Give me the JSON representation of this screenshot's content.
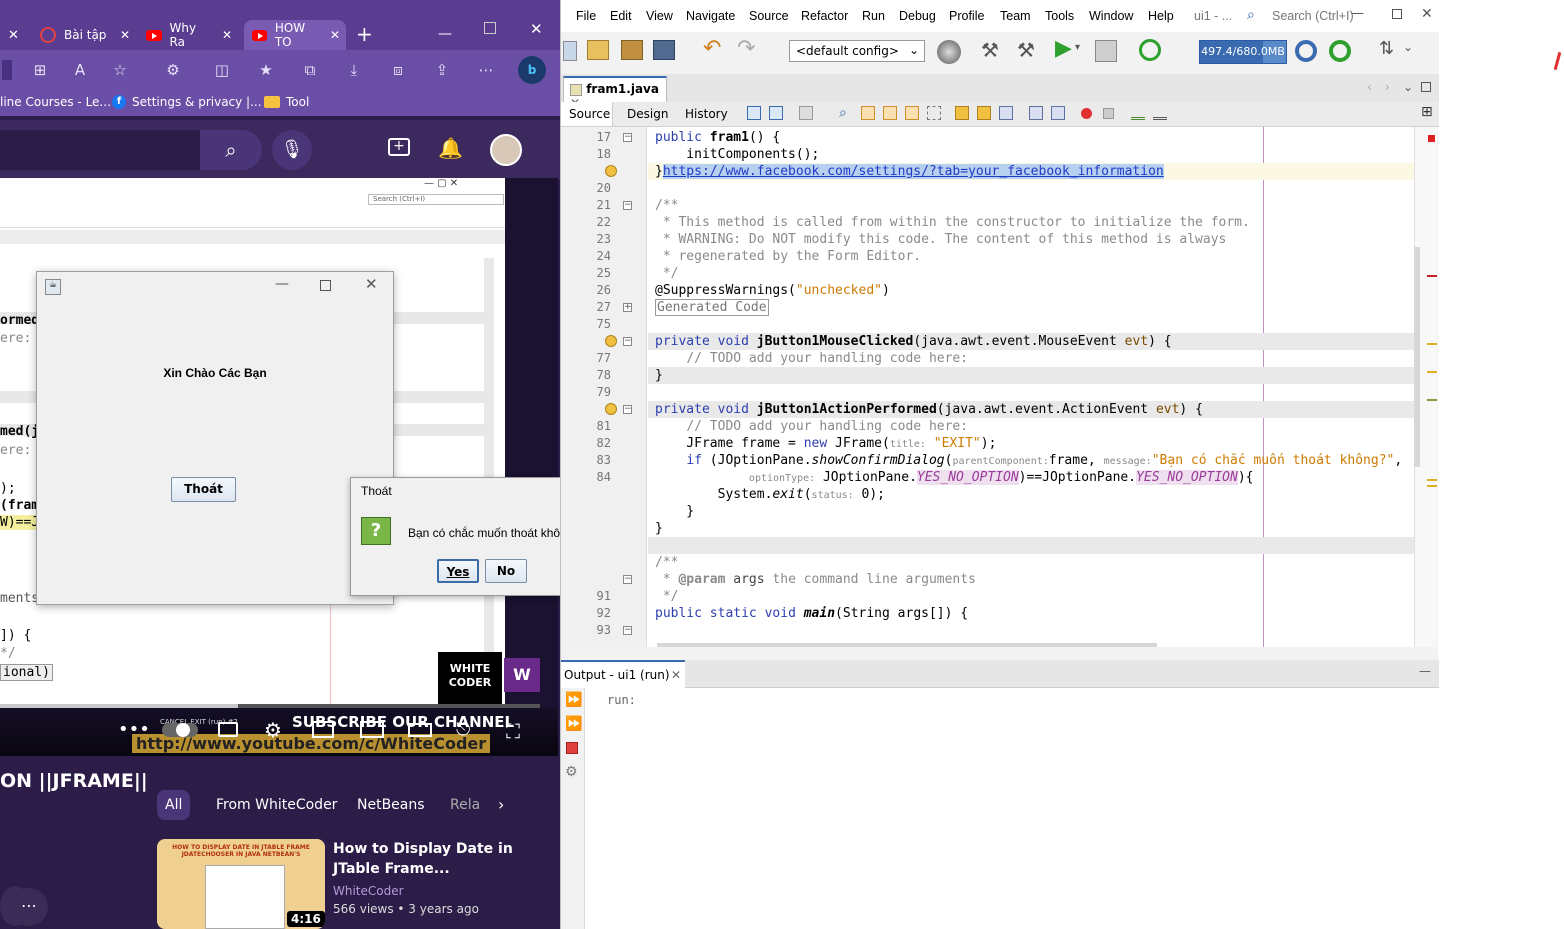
{
  "browser": {
    "tabs": [
      {
        "label": "",
        "active": false
      },
      {
        "label": "Bài tập",
        "active": false
      },
      {
        "label": "Why Ra",
        "active": false
      },
      {
        "label": "HOW TO",
        "active": true
      }
    ],
    "new_tab": "+",
    "favorites": [
      "line Courses - Le...",
      "Settings & privacy |...",
      "Tool"
    ],
    "video": {
      "dialog_title": "",
      "greeting": "Xin Chào Các Bạn",
      "exit_button": "Thoát",
      "confirm": {
        "title": "Thoát",
        "message": "Bạn có chắc muốn thoát không?",
        "yes": "Yes",
        "no": "No"
      },
      "code_fragments": [
        "ormed",
        "ere:",
        "med(j",
        "ere:",
        ");",
        "(fram",
        "W)==J",
        "ments",
        "]) {",
        "*/",
        "ional)"
      ],
      "watermark_title": "WHITE CODER",
      "subscribe_text": "SUBSCRIBE OUR CHANNEL",
      "channel_url": "http://www.youtube.com/c/WhiteCoder",
      "mini_caption": "CANCEL EXIT (run) #2",
      "mini_search": "Search (Ctrl+I)"
    },
    "video_title": "ON ||JFRAME||",
    "chips": [
      "All",
      "From WhiteCoder",
      "NetBeans",
      "Rela"
    ],
    "recommended": {
      "title": "How to Display Date in JTable Frame...",
      "channel": "WhiteCoder",
      "meta": "566 views • 3 years ago",
      "duration": "4:16",
      "thumb_text": "HOW TO DISPLAY DATE IN JTABLE FRAME JDATECHOOSER IN JAVA NETBEAN'S"
    }
  },
  "netbeans": {
    "menu": [
      "File",
      "Edit",
      "View",
      "Navigate",
      "Source",
      "Refactor",
      "Run",
      "Debug",
      "Profile",
      "Team",
      "Tools",
      "Window",
      "Help"
    ],
    "window_title": "ui1 - ...",
    "search_placeholder": "Search (Ctrl+I)",
    "config": "<default config>",
    "memory": "497.4/680.0MB",
    "memory_fill": 0.73,
    "file_tab": "fram1.java",
    "subtabs": [
      "Source",
      "Design",
      "History"
    ],
    "code": [
      {
        "n": "17",
        "html": "<span class='kw'>public</span> <b>fram1</b>() {"
      },
      {
        "n": "18",
        "html": "    initComponents();"
      },
      {
        "n": "",
        "html": "}<span style='color:#1f3bc7;text-decoration:underline;background:#b8d0f0'>https://www.facebook.com/settings/?tab=your_facebook_information</span>"
      },
      {
        "n": "20",
        "html": ""
      },
      {
        "n": "21",
        "html": "<span class='cm'>/**</span>"
      },
      {
        "n": "22",
        "html": "<span class='cm'> * This method is called from within the constructor to initialize the form.</span>"
      },
      {
        "n": "23",
        "html": "<span class='cm'> * WARNING: Do NOT modify this code. The content of this method is always</span>"
      },
      {
        "n": "24",
        "html": "<span class='cm'> * regenerated by the Form Editor.</span>"
      },
      {
        "n": "25",
        "html": "<span class='cm'> */</span>"
      },
      {
        "n": "26",
        "html": "@SuppressWarnings(<span class='st'>\"unchecked\"</span>)"
      },
      {
        "n": "27",
        "html": "<span style='border:1px solid #999;color:#777;padding:0 1px'>Generated Code</span>"
      },
      {
        "n": "75",
        "html": ""
      },
      {
        "n": "",
        "html": "<span class='kw'>private</span> <span class='kw'>void</span> <b>jButton1MouseClicked</b>(java.awt.event.MouseEvent <span style='color:#7a4a00'>evt</span>) {"
      },
      {
        "n": "77",
        "html": "    <span class='cm'>// TODO add your handling code here:</span>"
      },
      {
        "n": "78",
        "html": "}"
      },
      {
        "n": "79",
        "html": ""
      },
      {
        "n": "",
        "html": "<span class='kw'>private</span> <span class='kw'>void</span> <b>jButton1ActionPerformed</b>(java.awt.event.ActionEvent <span style='color:#7a4a00'>evt</span>) {"
      },
      {
        "n": "81",
        "html": "    <span class='cm'>// TODO add your handling code here:</span>"
      },
      {
        "n": "82",
        "html": "    JFrame frame = <span class='kw'>new</span> JFrame(<span class='hint'>title:</span> <span class='st'>\"EXIT\"</span>);"
      },
      {
        "n": "83",
        "html": "    <span class='kw'>if</span> (JOptionPane.<span class='it'>showConfirmDialog</span>(<span class='hint'>parentComponent:</span>frame, <span class='hint'>message:</span><span class='st'>\"Bạn có chắc muốn thoát không?\"</span>,"
      },
      {
        "n": "84",
        "html": "            <span class='hint'>optionType:</span> JOptionPane.<span class='it' style='color:#9b3b9b;background:#efe0ef'>YES_NO_OPTION</span>)==JOptionPane.<span class='it' style='color:#9b3b9b;background:#efe0ef'>YES_NO_OPTION</span>){"
      },
      {
        "n": "",
        "html": "        System.<span class='it'>exit</span>(<span class='hint'>status:</span> 0);"
      },
      {
        "n": "",
        "html": "    }"
      },
      {
        "n": "",
        "html": "}"
      },
      {
        "n": "",
        "html": ""
      },
      {
        "n": "",
        "html": "<span class='cm'>/**</span>"
      },
      {
        "n": "",
        "html": "<span class='cm'> * <b>@param</b> <span style='color:#444'>args</span> the command line arguments</span>"
      },
      {
        "n": "91",
        "html": "<span class='cm'> */</span>"
      },
      {
        "n": "92",
        "html": "<span class='kw'>public</span> <span class='kw'>static</span> <span class='kw'>void</span> <b class='it'>main</b>(String args[]) {"
      },
      {
        "n": "93",
        "html": ""
      }
    ],
    "output_tab": "Output - ui1 (run)",
    "output_text": "run:"
  }
}
